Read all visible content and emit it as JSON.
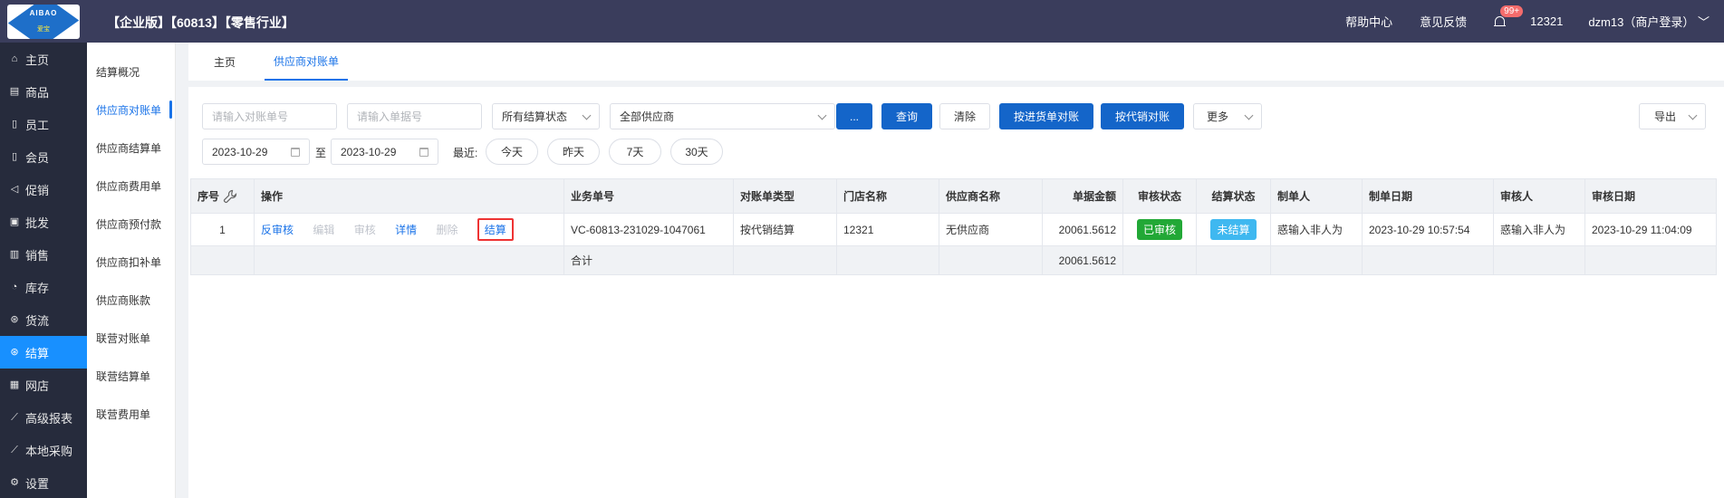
{
  "header": {
    "logo_text": "AIBAO",
    "logo_sub": "爱宝",
    "title": "【企业版】【60813】【零售行业】",
    "help": "帮助中心",
    "feedback": "意见反馈",
    "badge": "99+",
    "store_num": "12321",
    "user": "dzm13（商户登录）"
  },
  "sidebar": {
    "items": [
      {
        "label": "主页",
        "icon": "home-icon"
      },
      {
        "label": "商品",
        "icon": "goods-icon"
      },
      {
        "label": "员工",
        "icon": "staff-icon"
      },
      {
        "label": "会员",
        "icon": "member-icon"
      },
      {
        "label": "促销",
        "icon": "promo-icon"
      },
      {
        "label": "批发",
        "icon": "wholesale-icon"
      },
      {
        "label": "销售",
        "icon": "sales-icon"
      },
      {
        "label": "库存",
        "icon": "stock-icon"
      },
      {
        "label": "货流",
        "icon": "flow-icon"
      },
      {
        "label": "结算",
        "icon": "settle-icon"
      },
      {
        "label": "网店",
        "icon": "shop-icon"
      },
      {
        "label": "高级报表",
        "icon": "report-icon"
      },
      {
        "label": "本地采购",
        "icon": "purchase-icon"
      },
      {
        "label": "设置",
        "icon": "settings-icon"
      }
    ]
  },
  "submenu": {
    "items": [
      "结算概况",
      "供应商对账单",
      "供应商结算单",
      "供应商费用单",
      "供应商预付款",
      "供应商扣补单",
      "供应商账款",
      "联营对账单",
      "联营结算单",
      "联营费用单"
    ]
  },
  "tabs": [
    "主页",
    "供应商对账单"
  ],
  "filters": {
    "recon_no_placeholder": "请输入对账单号",
    "inbound_no_placeholder": "请输入单据号",
    "settle_status": "所有结算状态",
    "supplier": "全部供应商",
    "more_dots": "...",
    "query": "查询",
    "clear": "清除",
    "by_purchase": "按进货单对账",
    "by_consign": "按代销对账",
    "more": "更多",
    "export": "导出",
    "date_from": "2023-10-29",
    "date_sep": "至",
    "date_to": "2023-10-29",
    "recent_label": "最近:",
    "quick": [
      "今天",
      "昨天",
      "7天",
      "30天"
    ]
  },
  "table": {
    "headers": [
      "序号",
      "操作",
      "业务单号",
      "对账单类型",
      "门店名称",
      "供应商名称",
      "单据金额",
      "审核状态",
      "结算状态",
      "制单人",
      "制单日期",
      "审核人",
      "审核日期"
    ],
    "rows": [
      {
        "index": "1",
        "ops": {
          "unaudit": "反审核",
          "edit": "编辑",
          "audit": "审核",
          "detail": "详情",
          "delete": "删除",
          "settle": "结算"
        },
        "biz_no": "VC-60813-231029-1047061",
        "type": "按代销结算",
        "store": "12321",
        "supplier": "无供应商",
        "amount": "20061.5612",
        "audit_status": "已审核",
        "settle_status": "未结算",
        "creator": "惑输入非人为",
        "create_date": "2023-10-29 10:57:54",
        "auditor": "惑输入非人为",
        "audit_date": "2023-10-29 11:04:09"
      }
    ],
    "summary": {
      "label": "合计",
      "amount": "20061.5612"
    }
  }
}
